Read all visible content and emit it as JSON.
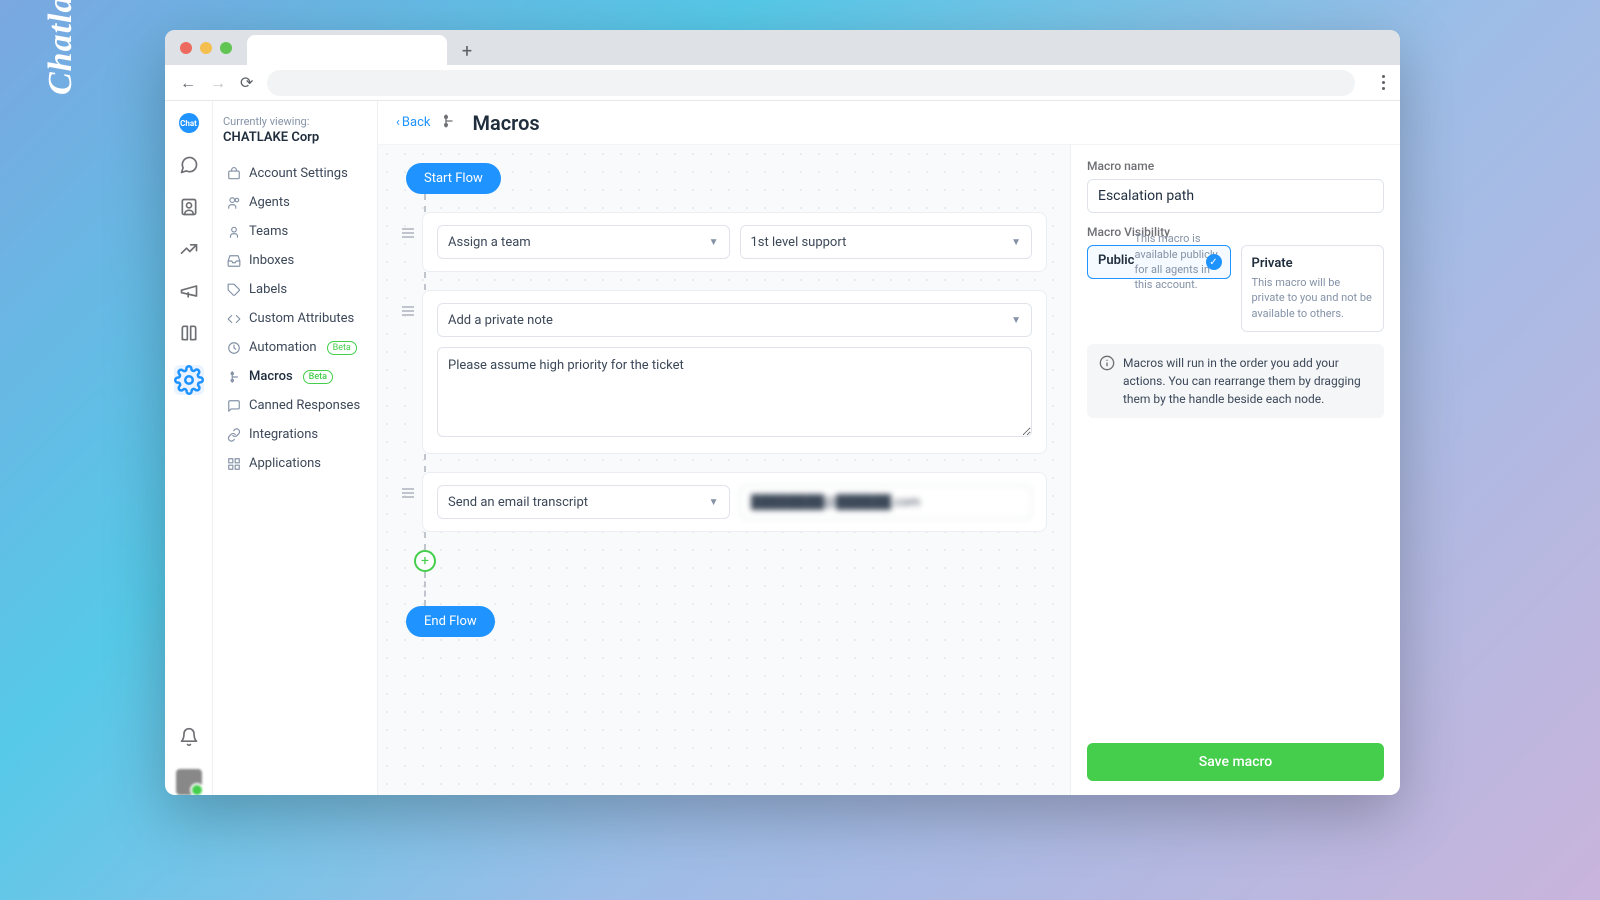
{
  "brand": "Chatlake",
  "traffic": {
    "red": "#ed6a5e",
    "yellow": "#f5bf4f",
    "green": "#61c554"
  },
  "sidebar": {
    "viewing_label": "Currently viewing:",
    "org": "CHATLAKE Corp",
    "items": [
      {
        "label": "Account Settings"
      },
      {
        "label": "Agents"
      },
      {
        "label": "Teams"
      },
      {
        "label": "Inboxes"
      },
      {
        "label": "Labels"
      },
      {
        "label": "Custom Attributes"
      },
      {
        "label": "Automation",
        "beta": "Beta"
      },
      {
        "label": "Macros",
        "beta": "Beta"
      },
      {
        "label": "Canned Responses"
      },
      {
        "label": "Integrations"
      },
      {
        "label": "Applications"
      }
    ]
  },
  "crumb": {
    "back": "Back",
    "title": "Macros"
  },
  "flow": {
    "start": "Start Flow",
    "end": "End Flow",
    "nodes": [
      {
        "action": "Assign a team",
        "value": "1st level support",
        "type": "select-select"
      },
      {
        "action": "Add a private note",
        "note": "Please assume high priority for the ticket",
        "type": "select-textarea"
      },
      {
        "action": "Send an email transcript",
        "value": "████████@██████.com",
        "type": "select-input"
      }
    ]
  },
  "panel": {
    "name_label": "Macro name",
    "name_value": "Escalation path",
    "vis_label": "Macro Visibility",
    "pub": {
      "title": "Public",
      "desc": "This macro is available publicly for all agents in this account."
    },
    "priv": {
      "title": "Private",
      "desc": "This macro will be private to you and not be available to others."
    },
    "info": "Macros will run in the order you add your actions. You can rearrange them by dragging them by the handle beside each node.",
    "save": "Save macro"
  }
}
